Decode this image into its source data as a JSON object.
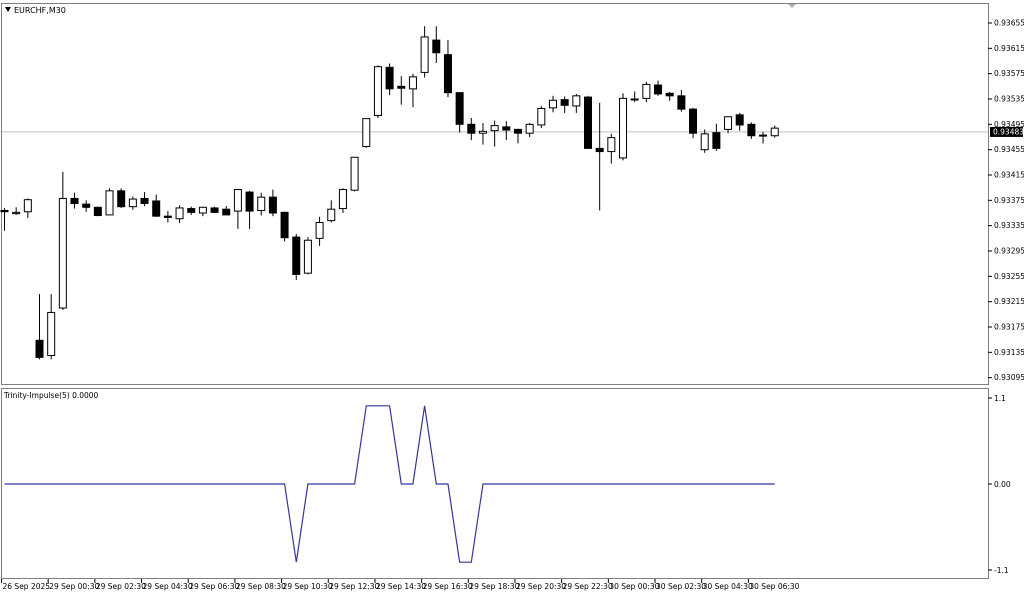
{
  "symbol_label": "EURCHF,M30",
  "indicator_label": "Trinity-Impulse(5) 0.0000",
  "current_price_label": "0.93483",
  "colors": {
    "background": "#ffffff",
    "frame": "#7f7f7f",
    "bull_fill": "#ffffff",
    "bear_fill": "#000000",
    "candle_outline": "#000000",
    "price_line": "#c0c0c0",
    "indicator_line": "#3535a0",
    "price_box_bg": "#000000",
    "price_box_text": "#ffffff",
    "text": "#000000"
  },
  "chart_data": [
    {
      "type": "candlestick",
      "title": "EURCHF,M30",
      "ylim": [
        0.93085,
        0.93685
      ],
      "current_price": 0.93483,
      "yticks": [
        "0.93655",
        "0.93615",
        "0.93575",
        "0.93535",
        "0.93495",
        "0.93455",
        "0.93415",
        "0.93375",
        "0.93335",
        "0.93295",
        "0.93255",
        "0.93215",
        "0.93175",
        "0.93135",
        "0.93095"
      ],
      "ytick_values": [
        0.93655,
        0.93615,
        0.93575,
        0.93535,
        0.93495,
        0.93455,
        0.93415,
        0.93375,
        0.93335,
        0.93295,
        0.93255,
        0.93215,
        0.93175,
        0.93135,
        0.93095
      ],
      "candles": [
        {
          "o": 0.93359,
          "h": 0.93363,
          "l": 0.93327,
          "c": 0.93357
        },
        {
          "o": 0.93354,
          "h": 0.93364,
          "l": 0.93352,
          "c": 0.93356
        },
        {
          "o": 0.93357,
          "h": 0.93378,
          "l": 0.93347,
          "c": 0.93376
        },
        {
          "o": 0.93154,
          "h": 0.93227,
          "l": 0.93124,
          "c": 0.93127
        },
        {
          "o": 0.9313,
          "h": 0.93227,
          "l": 0.93124,
          "c": 0.93198
        },
        {
          "o": 0.93205,
          "h": 0.9342,
          "l": 0.93202,
          "c": 0.93378
        },
        {
          "o": 0.93378,
          "h": 0.93387,
          "l": 0.93362,
          "c": 0.9337
        },
        {
          "o": 0.93369,
          "h": 0.93375,
          "l": 0.93357,
          "c": 0.93364
        },
        {
          "o": 0.93364,
          "h": 0.93365,
          "l": 0.9335,
          "c": 0.93351
        },
        {
          "o": 0.93352,
          "h": 0.93394,
          "l": 0.93352,
          "c": 0.9339
        },
        {
          "o": 0.9339,
          "h": 0.93394,
          "l": 0.93363,
          "c": 0.93365
        },
        {
          "o": 0.93365,
          "h": 0.93381,
          "l": 0.9336,
          "c": 0.93377
        },
        {
          "o": 0.93378,
          "h": 0.93388,
          "l": 0.93366,
          "c": 0.9337
        },
        {
          "o": 0.93374,
          "h": 0.93384,
          "l": 0.93349,
          "c": 0.9335
        },
        {
          "o": 0.9335,
          "h": 0.93358,
          "l": 0.9334,
          "c": 0.93348
        },
        {
          "o": 0.93346,
          "h": 0.93367,
          "l": 0.93339,
          "c": 0.93363
        },
        {
          "o": 0.93362,
          "h": 0.93365,
          "l": 0.93352,
          "c": 0.93356
        },
        {
          "o": 0.93355,
          "h": 0.93365,
          "l": 0.9335,
          "c": 0.93364
        },
        {
          "o": 0.93363,
          "h": 0.93365,
          "l": 0.93355,
          "c": 0.93356
        },
        {
          "o": 0.93361,
          "h": 0.93366,
          "l": 0.93352,
          "c": 0.93352
        },
        {
          "o": 0.93358,
          "h": 0.93393,
          "l": 0.9333,
          "c": 0.93392
        },
        {
          "o": 0.93388,
          "h": 0.9339,
          "l": 0.9333,
          "c": 0.93358
        },
        {
          "o": 0.93359,
          "h": 0.93387,
          "l": 0.93351,
          "c": 0.9338
        },
        {
          "o": 0.9338,
          "h": 0.93392,
          "l": 0.9335,
          "c": 0.93355
        },
        {
          "o": 0.93356,
          "h": 0.93357,
          "l": 0.9331,
          "c": 0.93316
        },
        {
          "o": 0.93317,
          "h": 0.93322,
          "l": 0.93249,
          "c": 0.93258
        },
        {
          "o": 0.9326,
          "h": 0.93317,
          "l": 0.93258,
          "c": 0.93312
        },
        {
          "o": 0.93315,
          "h": 0.93349,
          "l": 0.93303,
          "c": 0.9334
        },
        {
          "o": 0.93343,
          "h": 0.93375,
          "l": 0.9334,
          "c": 0.93361
        },
        {
          "o": 0.93362,
          "h": 0.93394,
          "l": 0.93355,
          "c": 0.93392
        },
        {
          "o": 0.93391,
          "h": 0.93443,
          "l": 0.93389,
          "c": 0.93443
        },
        {
          "o": 0.9346,
          "h": 0.93504,
          "l": 0.93458,
          "c": 0.93504
        },
        {
          "o": 0.93509,
          "h": 0.93588,
          "l": 0.93505,
          "c": 0.93586
        },
        {
          "o": 0.93585,
          "h": 0.93591,
          "l": 0.93541,
          "c": 0.93551
        },
        {
          "o": 0.93555,
          "h": 0.93571,
          "l": 0.93526,
          "c": 0.93552
        },
        {
          "o": 0.93551,
          "h": 0.93575,
          "l": 0.93522,
          "c": 0.9357
        },
        {
          "o": 0.93577,
          "h": 0.9365,
          "l": 0.93569,
          "c": 0.93633
        },
        {
          "o": 0.93628,
          "h": 0.9365,
          "l": 0.93592,
          "c": 0.93608
        },
        {
          "o": 0.93605,
          "h": 0.93628,
          "l": 0.93538,
          "c": 0.93545
        },
        {
          "o": 0.93545,
          "h": 0.93546,
          "l": 0.93482,
          "c": 0.93495
        },
        {
          "o": 0.93495,
          "h": 0.93505,
          "l": 0.9347,
          "c": 0.93481
        },
        {
          "o": 0.93481,
          "h": 0.93497,
          "l": 0.93463,
          "c": 0.93484
        },
        {
          "o": 0.93485,
          "h": 0.93501,
          "l": 0.9346,
          "c": 0.93493
        },
        {
          "o": 0.93491,
          "h": 0.935,
          "l": 0.9347,
          "c": 0.93486
        },
        {
          "o": 0.93487,
          "h": 0.93488,
          "l": 0.93465,
          "c": 0.93481
        },
        {
          "o": 0.93481,
          "h": 0.93497,
          "l": 0.93475,
          "c": 0.93495
        },
        {
          "o": 0.93494,
          "h": 0.93524,
          "l": 0.93489,
          "c": 0.9352
        },
        {
          "o": 0.93521,
          "h": 0.9354,
          "l": 0.93514,
          "c": 0.93533
        },
        {
          "o": 0.93534,
          "h": 0.93539,
          "l": 0.93513,
          "c": 0.93525
        },
        {
          "o": 0.93524,
          "h": 0.93543,
          "l": 0.93513,
          "c": 0.9354
        },
        {
          "o": 0.93538,
          "h": 0.9354,
          "l": 0.93464,
          "c": 0.93457
        },
        {
          "o": 0.93457,
          "h": 0.93529,
          "l": 0.93359,
          "c": 0.93452
        },
        {
          "o": 0.93452,
          "h": 0.9348,
          "l": 0.93433,
          "c": 0.93474
        },
        {
          "o": 0.93442,
          "h": 0.93544,
          "l": 0.93438,
          "c": 0.93536
        },
        {
          "o": 0.93534,
          "h": 0.93547,
          "l": 0.9353,
          "c": 0.93535
        },
        {
          "o": 0.93536,
          "h": 0.93562,
          "l": 0.9353,
          "c": 0.93558
        },
        {
          "o": 0.93557,
          "h": 0.93564,
          "l": 0.9354,
          "c": 0.93543
        },
        {
          "o": 0.93544,
          "h": 0.93546,
          "l": 0.93532,
          "c": 0.9354
        },
        {
          "o": 0.9354,
          "h": 0.93549,
          "l": 0.93515,
          "c": 0.93519
        },
        {
          "o": 0.93519,
          "h": 0.93521,
          "l": 0.93473,
          "c": 0.93481
        },
        {
          "o": 0.93455,
          "h": 0.93487,
          "l": 0.9345,
          "c": 0.9348
        },
        {
          "o": 0.93482,
          "h": 0.93496,
          "l": 0.93453,
          "c": 0.93457
        },
        {
          "o": 0.93487,
          "h": 0.93507,
          "l": 0.93481,
          "c": 0.93507
        },
        {
          "o": 0.9351,
          "h": 0.93513,
          "l": 0.93485,
          "c": 0.93494
        },
        {
          "o": 0.93495,
          "h": 0.93498,
          "l": 0.93472,
          "c": 0.93477
        },
        {
          "o": 0.93478,
          "h": 0.93483,
          "l": 0.93465,
          "c": 0.93478
        },
        {
          "o": 0.93477,
          "h": 0.93493,
          "l": 0.93474,
          "c": 0.93489
        }
      ],
      "xtick_labels": [
        "26 Sep 2025",
        "29 Sep 00:30",
        "29 Sep 02:30",
        "29 Sep 04:30",
        "29 Sep 06:30",
        "29 Sep 08:30",
        "29 Sep 10:30",
        "29 Sep 12:30",
        "29 Sep 14:30",
        "29 Sep 16:30",
        "29 Sep 18:30",
        "29 Sep 20:30",
        "29 Sep 22:30",
        "30 Sep 00:30",
        "30 Sep 02:30",
        "30 Sep 04:30",
        "30 Sep 06:30"
      ],
      "xtick_bar_index": [
        0,
        4,
        8,
        12,
        16,
        20,
        24,
        28,
        32,
        36,
        40,
        44,
        48,
        52,
        56,
        60,
        64
      ]
    },
    {
      "type": "line",
      "title": "Trinity-Impulse(5) 0.0000",
      "ylim": [
        -1.1,
        1.1
      ],
      "yticks": [
        "1.1",
        "0.00",
        "-1.1"
      ],
      "ytick_values": [
        1.1,
        0.0,
        -1.1
      ],
      "series": [
        {
          "values": [
            0,
            0,
            0,
            0,
            0,
            0,
            0,
            0,
            0,
            0,
            0,
            0,
            0,
            0,
            0,
            0,
            0,
            0,
            0,
            0,
            0,
            0,
            0,
            0,
            0,
            -1,
            0,
            0,
            0,
            0,
            0,
            1,
            1,
            1,
            0,
            0,
            1,
            0,
            0,
            -1,
            -1,
            0,
            0,
            0,
            0,
            0,
            0,
            0,
            0,
            0,
            0,
            0,
            0,
            0,
            0,
            0,
            0,
            0,
            0,
            0,
            0,
            0,
            0,
            0,
            0,
            0,
            0
          ]
        }
      ]
    }
  ]
}
